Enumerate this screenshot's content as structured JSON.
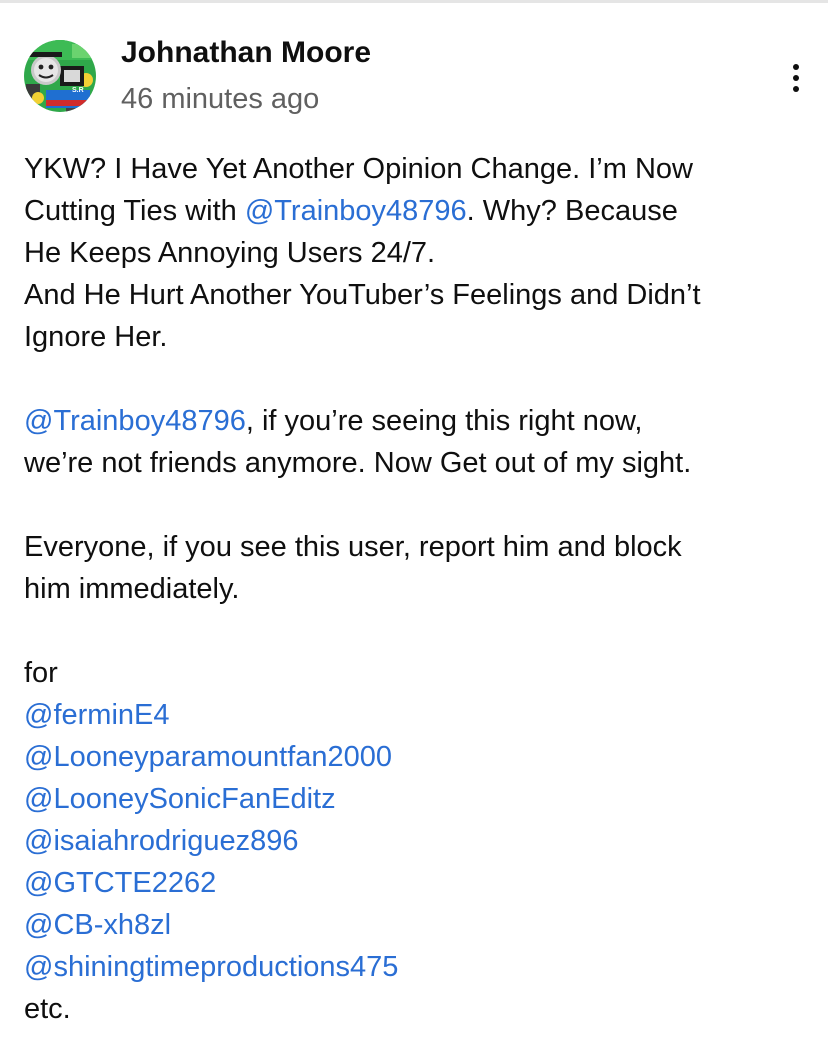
{
  "post": {
    "author": "Johnathan Moore",
    "time": "46 minutes ago",
    "menu_icon": "vertical-ellipsis-icon",
    "avatar_icon": "train-cartoon-avatar",
    "avatar_badge_text": "S.R",
    "paragraph1": {
      "l1": "YKW? I Have Yet Another Opinion Change. I’m Now",
      "l2a": "Cutting Ties with ",
      "l2_mention": "@Trainboy48796",
      "l2b": ". Why? Because",
      "l3": "He Keeps Annoying Users 24/7.",
      "l4": "And He Hurt Another YouTuber’s Feelings and Didn’t",
      "l5": "Ignore Her."
    },
    "paragraph2": {
      "l1_mention": "@Trainboy48796",
      "l1b": ", if you’re seeing this right now,",
      "l2": "we’re not friends anymore. Now Get out of my sight."
    },
    "paragraph3": {
      "l1": "Everyone, if you see this user, report him and block",
      "l2": "him immediately."
    },
    "for_label": "for",
    "mentions": [
      "@ferminE4",
      "@Looneyparamountfan2000",
      "@LooneySonicFanEditz",
      "@isaiahrodriguez896",
      "@GTCTE2262",
      "@CB-xh8zl",
      "@shiningtimeproductions475"
    ],
    "etc_label": "etc.",
    "colors": {
      "text": "#0f0f0f",
      "secondary": "#606060",
      "link": "#2a6ed4",
      "avatar_green": "#2fa84a"
    }
  }
}
